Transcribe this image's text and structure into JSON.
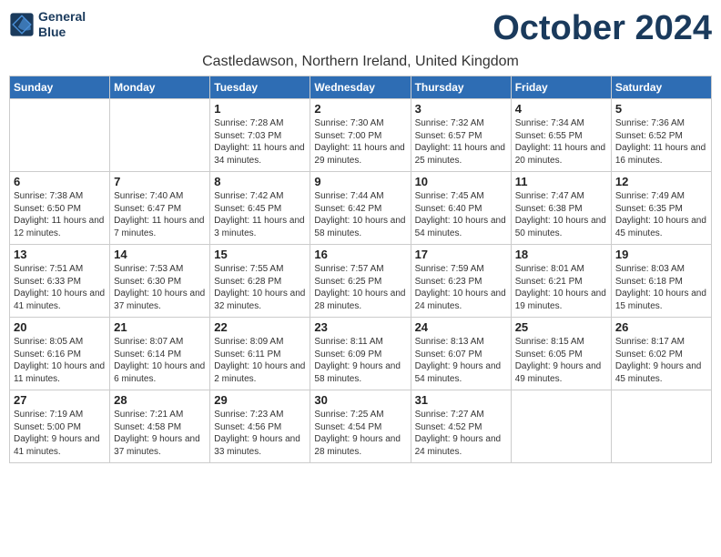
{
  "header": {
    "logo_line1": "General",
    "logo_line2": "Blue",
    "month": "October 2024",
    "location": "Castledawson, Northern Ireland, United Kingdom"
  },
  "weekdays": [
    "Sunday",
    "Monday",
    "Tuesday",
    "Wednesday",
    "Thursday",
    "Friday",
    "Saturday"
  ],
  "weeks": [
    [
      {
        "day": "",
        "empty": true
      },
      {
        "day": "",
        "empty": true
      },
      {
        "day": "1",
        "sunrise": "7:28 AM",
        "sunset": "7:03 PM",
        "daylight": "11 hours and 34 minutes."
      },
      {
        "day": "2",
        "sunrise": "7:30 AM",
        "sunset": "7:00 PM",
        "daylight": "11 hours and 29 minutes."
      },
      {
        "day": "3",
        "sunrise": "7:32 AM",
        "sunset": "6:57 PM",
        "daylight": "11 hours and 25 minutes."
      },
      {
        "day": "4",
        "sunrise": "7:34 AM",
        "sunset": "6:55 PM",
        "daylight": "11 hours and 20 minutes."
      },
      {
        "day": "5",
        "sunrise": "7:36 AM",
        "sunset": "6:52 PM",
        "daylight": "11 hours and 16 minutes."
      }
    ],
    [
      {
        "day": "6",
        "sunrise": "7:38 AM",
        "sunset": "6:50 PM",
        "daylight": "11 hours and 12 minutes."
      },
      {
        "day": "7",
        "sunrise": "7:40 AM",
        "sunset": "6:47 PM",
        "daylight": "11 hours and 7 minutes."
      },
      {
        "day": "8",
        "sunrise": "7:42 AM",
        "sunset": "6:45 PM",
        "daylight": "11 hours and 3 minutes."
      },
      {
        "day": "9",
        "sunrise": "7:44 AM",
        "sunset": "6:42 PM",
        "daylight": "10 hours and 58 minutes."
      },
      {
        "day": "10",
        "sunrise": "7:45 AM",
        "sunset": "6:40 PM",
        "daylight": "10 hours and 54 minutes."
      },
      {
        "day": "11",
        "sunrise": "7:47 AM",
        "sunset": "6:38 PM",
        "daylight": "10 hours and 50 minutes."
      },
      {
        "day": "12",
        "sunrise": "7:49 AM",
        "sunset": "6:35 PM",
        "daylight": "10 hours and 45 minutes."
      }
    ],
    [
      {
        "day": "13",
        "sunrise": "7:51 AM",
        "sunset": "6:33 PM",
        "daylight": "10 hours and 41 minutes."
      },
      {
        "day": "14",
        "sunrise": "7:53 AM",
        "sunset": "6:30 PM",
        "daylight": "10 hours and 37 minutes."
      },
      {
        "day": "15",
        "sunrise": "7:55 AM",
        "sunset": "6:28 PM",
        "daylight": "10 hours and 32 minutes."
      },
      {
        "day": "16",
        "sunrise": "7:57 AM",
        "sunset": "6:25 PM",
        "daylight": "10 hours and 28 minutes."
      },
      {
        "day": "17",
        "sunrise": "7:59 AM",
        "sunset": "6:23 PM",
        "daylight": "10 hours and 24 minutes."
      },
      {
        "day": "18",
        "sunrise": "8:01 AM",
        "sunset": "6:21 PM",
        "daylight": "10 hours and 19 minutes."
      },
      {
        "day": "19",
        "sunrise": "8:03 AM",
        "sunset": "6:18 PM",
        "daylight": "10 hours and 15 minutes."
      }
    ],
    [
      {
        "day": "20",
        "sunrise": "8:05 AM",
        "sunset": "6:16 PM",
        "daylight": "10 hours and 11 minutes."
      },
      {
        "day": "21",
        "sunrise": "8:07 AM",
        "sunset": "6:14 PM",
        "daylight": "10 hours and 6 minutes."
      },
      {
        "day": "22",
        "sunrise": "8:09 AM",
        "sunset": "6:11 PM",
        "daylight": "10 hours and 2 minutes."
      },
      {
        "day": "23",
        "sunrise": "8:11 AM",
        "sunset": "6:09 PM",
        "daylight": "9 hours and 58 minutes."
      },
      {
        "day": "24",
        "sunrise": "8:13 AM",
        "sunset": "6:07 PM",
        "daylight": "9 hours and 54 minutes."
      },
      {
        "day": "25",
        "sunrise": "8:15 AM",
        "sunset": "6:05 PM",
        "daylight": "9 hours and 49 minutes."
      },
      {
        "day": "26",
        "sunrise": "8:17 AM",
        "sunset": "6:02 PM",
        "daylight": "9 hours and 45 minutes."
      }
    ],
    [
      {
        "day": "27",
        "sunrise": "7:19 AM",
        "sunset": "5:00 PM",
        "daylight": "9 hours and 41 minutes."
      },
      {
        "day": "28",
        "sunrise": "7:21 AM",
        "sunset": "4:58 PM",
        "daylight": "9 hours and 37 minutes."
      },
      {
        "day": "29",
        "sunrise": "7:23 AM",
        "sunset": "4:56 PM",
        "daylight": "9 hours and 33 minutes."
      },
      {
        "day": "30",
        "sunrise": "7:25 AM",
        "sunset": "4:54 PM",
        "daylight": "9 hours and 28 minutes."
      },
      {
        "day": "31",
        "sunrise": "7:27 AM",
        "sunset": "4:52 PM",
        "daylight": "9 hours and 24 minutes."
      },
      {
        "day": "",
        "empty": true
      },
      {
        "day": "",
        "empty": true
      }
    ]
  ]
}
